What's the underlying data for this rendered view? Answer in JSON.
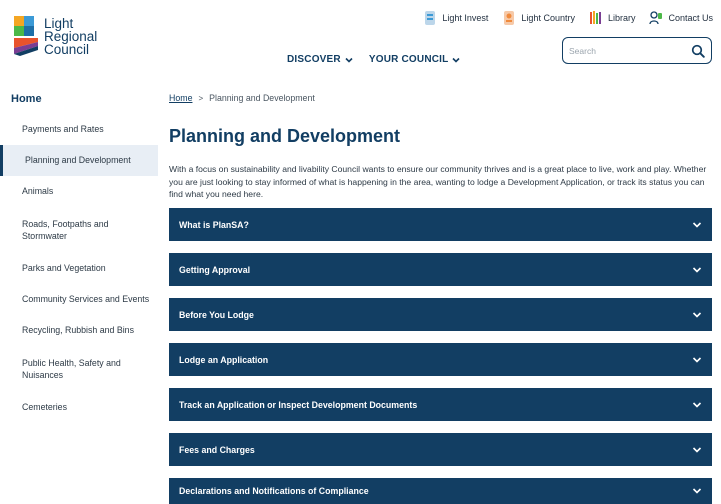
{
  "logo": {
    "line1": "Light",
    "line2": "Regional",
    "line3": "Council"
  },
  "toplinks": [
    {
      "label": "Light Invest",
      "icon": "light-invest-icon"
    },
    {
      "label": "Light Country",
      "icon": "light-country-icon"
    },
    {
      "label": "Library",
      "icon": "library-icon"
    },
    {
      "label": "Contact Us",
      "icon": "contact-us-icon"
    }
  ],
  "nav": {
    "discover": "DISCOVER",
    "your_council": "YOUR COUNCIL"
  },
  "search": {
    "placeholder": "Search"
  },
  "sidebar": {
    "home": "Home",
    "items": [
      "Payments and Rates",
      "Planning and Development",
      "Animals",
      "Roads, Footpaths and Stormwater",
      "Parks and Vegetation",
      "Community Services and Events",
      "Recycling, Rubbish and Bins",
      "Public Health, Safety and Nuisances",
      "Cemeteries"
    ]
  },
  "breadcrumb": {
    "home": "Home",
    "separator": ">",
    "current": "Planning and Development"
  },
  "page": {
    "title": "Planning and Development",
    "intro": "With a focus on sustainability and livability Council wants to ensure our community thrives and is a great place to live, work and play. Whether you are just looking to stay informed of what is happening in the area, wanting to lodge a Development Application, or track its status you can find what you need here."
  },
  "accordions": [
    "What is PlanSA?",
    "Getting Approval",
    "Before You Lodge",
    "Lodge an Application",
    "Track an Application or Inspect Development Documents",
    "Fees and Charges",
    "Declarations and Notifications of Compliance"
  ],
  "colors": {
    "brand_navy": "#123e63",
    "sidebar_active_bg": "#e8eef5"
  }
}
